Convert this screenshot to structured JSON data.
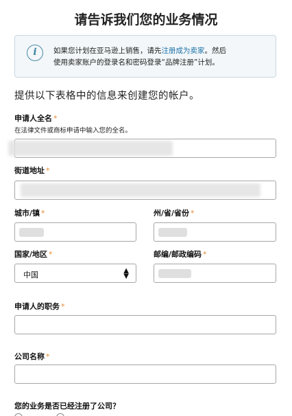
{
  "header": {
    "title": "请告诉我们您的业务情况"
  },
  "info": {
    "icon": "info-icon",
    "line1_prefix": "如果您计划在亚马逊上销售，请先",
    "line1_link": "注册成为卖家",
    "line1_suffix": "。然后",
    "line2": "使用卖家账户的登录名和密码登录“品牌注册”计划。"
  },
  "intro": "提供以下表格中的信息来创建您的帐户。",
  "form": {
    "required_mark": "*",
    "applicant_name": {
      "label": "申请人全名",
      "hint": "在法律文件或商标申请中输入您的全名。"
    },
    "street": {
      "label": "街道地址"
    },
    "city": {
      "label": "城市/镇"
    },
    "state": {
      "label": "州/省/省份"
    },
    "country": {
      "label": "国家/地区",
      "value": "中国",
      "arrow": "▲▼"
    },
    "postal": {
      "label": "邮编/邮政编码"
    },
    "title_role": {
      "label": "申请人的职务"
    },
    "company": {
      "label": "公司名称"
    },
    "registered_question": "您的业务是否已经注册了公司？"
  }
}
